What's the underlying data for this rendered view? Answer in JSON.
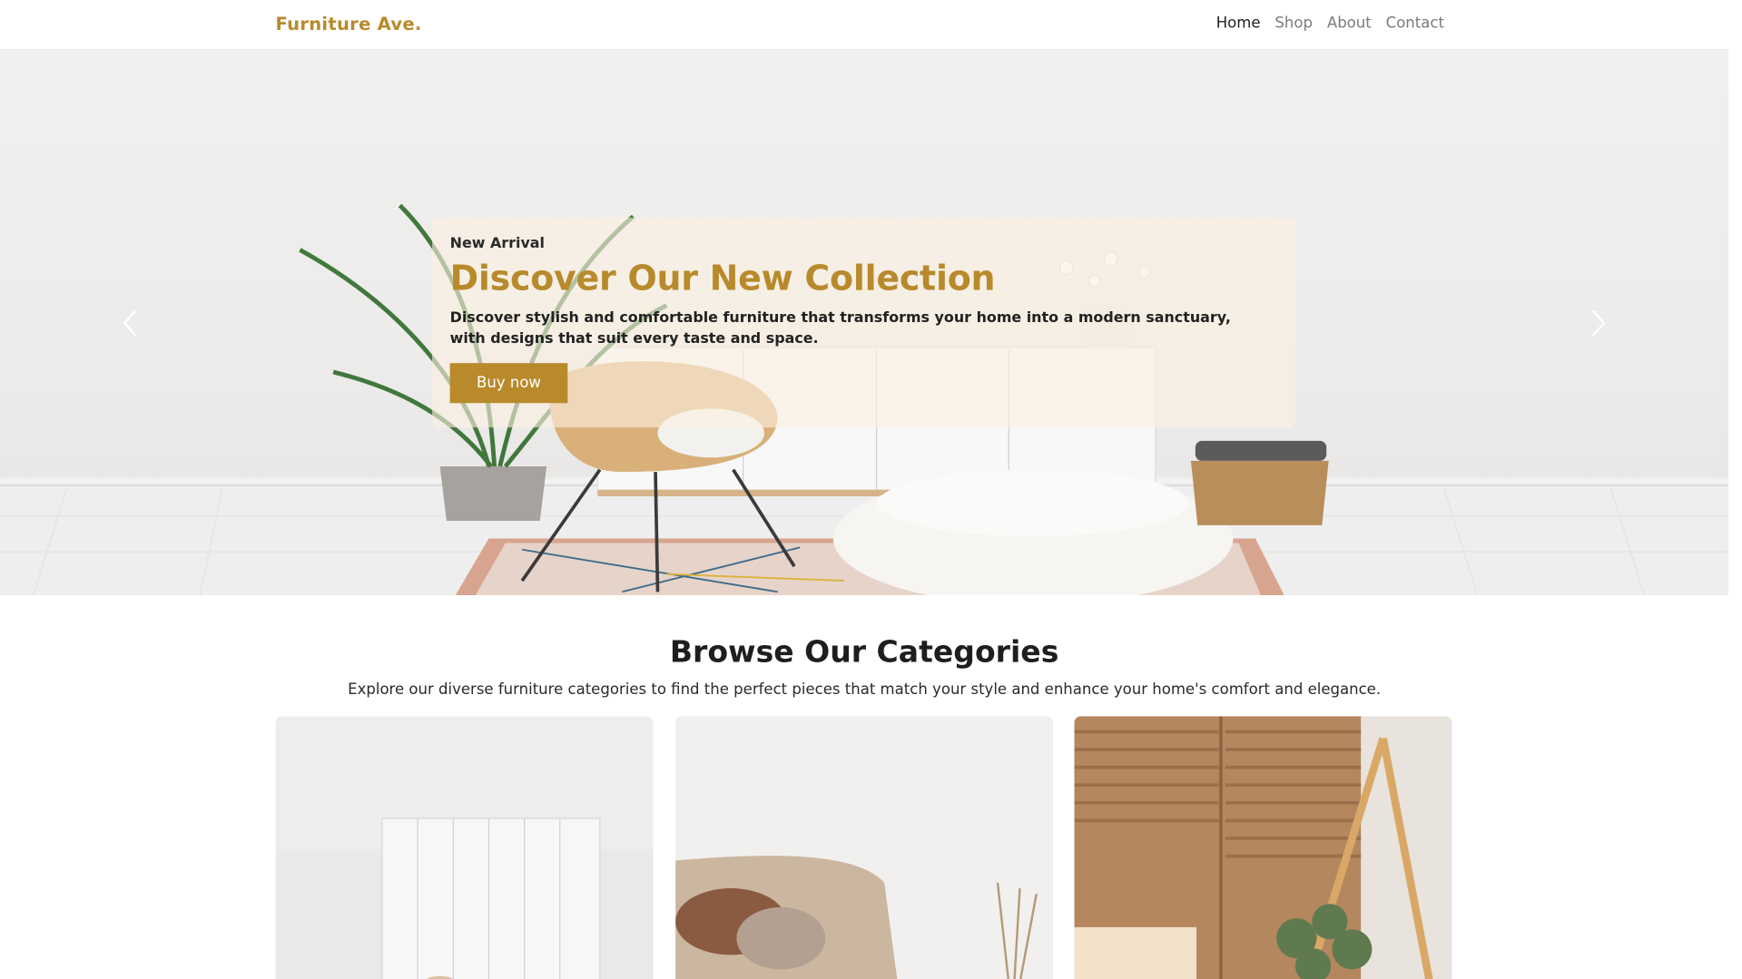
{
  "brand": {
    "name": "Furniture Ave."
  },
  "nav": {
    "items": [
      {
        "label": "Home",
        "active": true
      },
      {
        "label": "Shop",
        "active": false
      },
      {
        "label": "About",
        "active": false
      },
      {
        "label": "Contact",
        "active": false
      }
    ]
  },
  "hero": {
    "kicker": "New Arrival",
    "title": "Discover Our New Collection",
    "description": "Discover stylish and comfortable furniture that transforms your home into a modern sanctuary, with designs that suit every taste and space.",
    "cta_label": "Buy now",
    "prev_icon": "chevron-left-icon",
    "next_icon": "chevron-right-icon"
  },
  "categories": {
    "title": "Browse Our Categories",
    "subtitle": "Explore our diverse furniture categories to find the perfect pieces that match your style and enhance your home's comfort and elegance."
  },
  "colors": {
    "accent": "#b88a2c",
    "caption_bg": "#fcf0e0",
    "text_dark": "#212529",
    "nav_muted": "#7b7b7b"
  }
}
